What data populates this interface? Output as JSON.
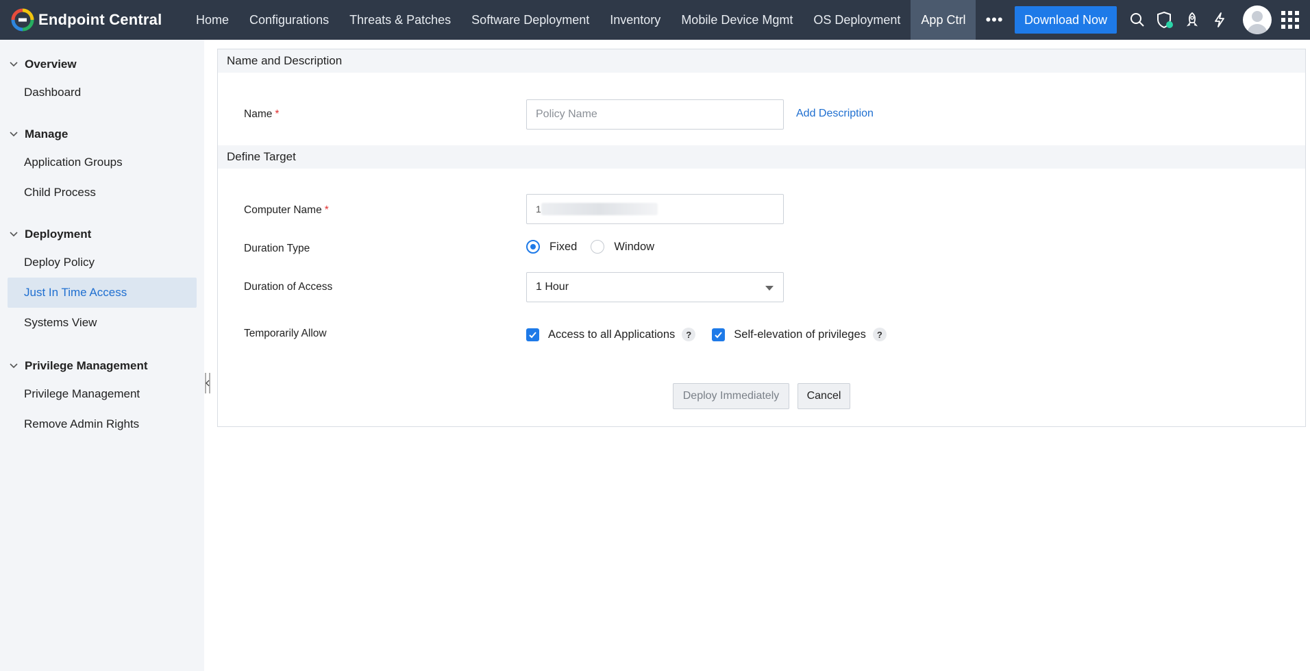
{
  "brand": {
    "name": "Endpoint Central"
  },
  "nav": {
    "items": [
      "Home",
      "Configurations",
      "Threats & Patches",
      "Software Deployment",
      "Inventory",
      "Mobile Device Mgmt",
      "OS Deployment",
      "App Ctrl"
    ],
    "active": "App Ctrl",
    "more": "•••"
  },
  "topbar": {
    "download_label": "Download Now",
    "icons": [
      "search-icon",
      "shield-icon",
      "rocket-icon",
      "lightning-icon",
      "avatar",
      "apps-grid-icon"
    ]
  },
  "sidebar": {
    "groups": [
      {
        "title": "Overview",
        "items": [
          "Dashboard"
        ]
      },
      {
        "title": "Manage",
        "items": [
          "Application Groups",
          "Child Process"
        ]
      },
      {
        "title": "Deployment",
        "items": [
          "Deploy Policy",
          "Just In Time Access",
          "Systems View"
        ]
      },
      {
        "title": "Privilege Management",
        "items": [
          "Privilege Management",
          "Remove Admin Rights"
        ]
      }
    ],
    "active_item": "Just In Time Access"
  },
  "form": {
    "section_name": "Name and Description",
    "name_label": "Name",
    "required_mark": "*",
    "name_placeholder": "Policy Name",
    "add_description": "Add Description",
    "section_target": "Define Target",
    "computer_label": "Computer Name",
    "computer_value_prefix": "1",
    "duration_type_label": "Duration Type",
    "duration_type_options": [
      "Fixed",
      "Window"
    ],
    "duration_type_selected": "Fixed",
    "duration_access_label": "Duration of Access",
    "duration_access_value": "1 Hour",
    "temp_allow_label": "Temporarily Allow",
    "temp_allow_options": [
      "Access to all Applications",
      "Self-elevation of privileges"
    ],
    "help_mark": "?",
    "deploy_label": "Deploy Immediately",
    "cancel_label": "Cancel"
  },
  "colors": {
    "topbar": "#2f3948",
    "accent": "#1e7ae8",
    "sidebar_bg": "#f3f5f8",
    "active_item_bg": "#dce6f1",
    "required": "#e03030"
  }
}
